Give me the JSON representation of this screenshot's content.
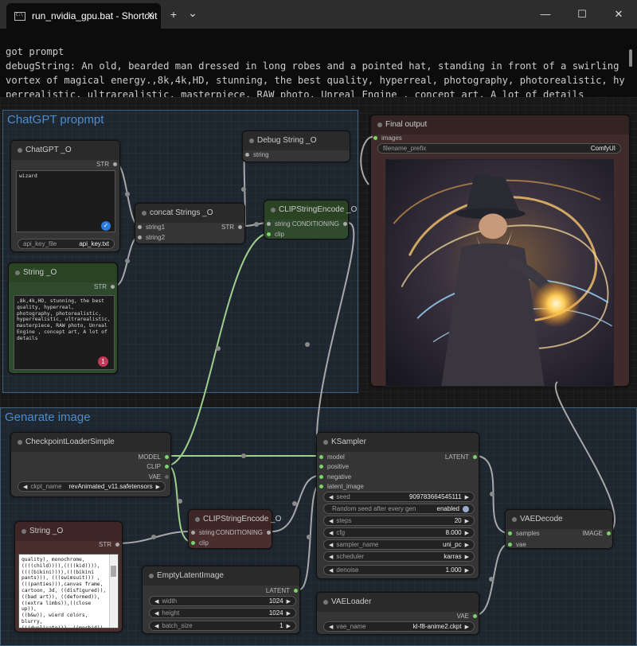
{
  "window": {
    "tab_title": "run_nvidia_gpu.bat - Shortcut",
    "close_tab": "✕",
    "new_tab": "+",
    "dropdown": "⌄",
    "minimize": "—",
    "maximize": "☐",
    "close": "✕"
  },
  "terminal": {
    "lines": "got prompt\ndebugString: An old, bearded man dressed in long robes and a pointed hat, standing in front of a swirling\nvortex of magical energy.,8k,4k,HD, stunning, the best quality, hyperreal, photography, photorealistic, hy\nperrealistic, ultrarealistic, masterpiece, RAW photo, Unreal Engine , concept art, A lot of details"
  },
  "groups": {
    "chatgpt": "ChatGPT propmpt",
    "generate": "Genarate image"
  },
  "nodes": {
    "chatgpt": {
      "title": "ChatGPT _O",
      "out": "STR",
      "text": "wizard",
      "api_key_label": "api_key_file",
      "api_key_value": "api_key.txt"
    },
    "debug_string": {
      "title": "Debug String _O",
      "in": "string"
    },
    "concat": {
      "title": "concat Strings _O",
      "in1": "string1",
      "in2": "string2",
      "out": "STR"
    },
    "clip_encode_pos": {
      "title": "CLIPStringEncode _O",
      "in1": "string",
      "in2": "clip",
      "out": "CONDITIONING"
    },
    "string_pos": {
      "title": "String _O",
      "out": "STR",
      "text": ",8k,4k,HD, stunning, the best quality, hyperreal, photography, photorealistic, hyperrealistic, ultrarealistic, masterpiece, RAW photo, Unreal Engine , concept art, A lot of details",
      "badge": "1"
    },
    "final_output": {
      "title": "Final output",
      "in": "images",
      "prefix_label": "filename_prefix",
      "prefix_value": "ComfyUI"
    },
    "checkpoint": {
      "title": "CheckpointLoaderSimple",
      "out1": "MODEL",
      "out2": "CLIP",
      "out3": "VAE",
      "ckpt_label": "ckpt_name",
      "ckpt_value": "revAnimated_v11.safetensors"
    },
    "ksampler": {
      "title": "KSampler",
      "in1": "model",
      "in2": "positive",
      "in3": "negative",
      "in4": "latent_image",
      "out": "LATENT",
      "widgets": [
        {
          "label": "seed",
          "value": "909783664545111"
        },
        {
          "label": "Random seed after every gen",
          "value": "enabled"
        },
        {
          "label": "steps",
          "value": "20"
        },
        {
          "label": "cfg",
          "value": "8.000"
        },
        {
          "label": "sampler_name",
          "value": "uni_pc"
        },
        {
          "label": "scheduler",
          "value": "karras"
        },
        {
          "label": "denoise",
          "value": "1.000"
        }
      ]
    },
    "clip_encode_neg": {
      "title": "CLIPStringEncode _O",
      "in1": "string",
      "in2": "clip",
      "out": "CONDITIONING"
    },
    "string_neg": {
      "title": "String _O",
      "out": "STR",
      "text": "quality), monochrome,\n((((child)))),((((kid)))),\n((((bikini)))),(((bikini\npants))), (((swimsuit))) ,\n(((panties))),canvas frame,\ncartoon, 3d, ((disfigured)),\n((bad art)), ((deformed)),\n((extra limbs)),((close up)),\n((b&w)), wierd colors, blurry,\n(((duplicate))), ((morbid)),\n((mutilated)), [out of frame],\nextra fingers, mutated hands,\n((poorly drawn hands)),"
    },
    "empty_latent": {
      "title": "EmptyLatentImage",
      "out": "LATENT",
      "widgets": [
        {
          "label": "width",
          "value": "1024"
        },
        {
          "label": "height",
          "value": "1024"
        },
        {
          "label": "batch_size",
          "value": "1"
        }
      ]
    },
    "vae_decode": {
      "title": "VAEDecode",
      "in1": "samples",
      "in2": "vae",
      "out": "IMAGE"
    },
    "vae_loader": {
      "title": "VAELoader",
      "out": "VAE",
      "vae_label": "vae_name",
      "vae_value": "kl-f8-anime2.ckpt"
    }
  },
  "colors": {
    "link_grey": "#a8a8a8",
    "link_green": "#9fcf8a",
    "group_title": "#4d8ccb"
  }
}
